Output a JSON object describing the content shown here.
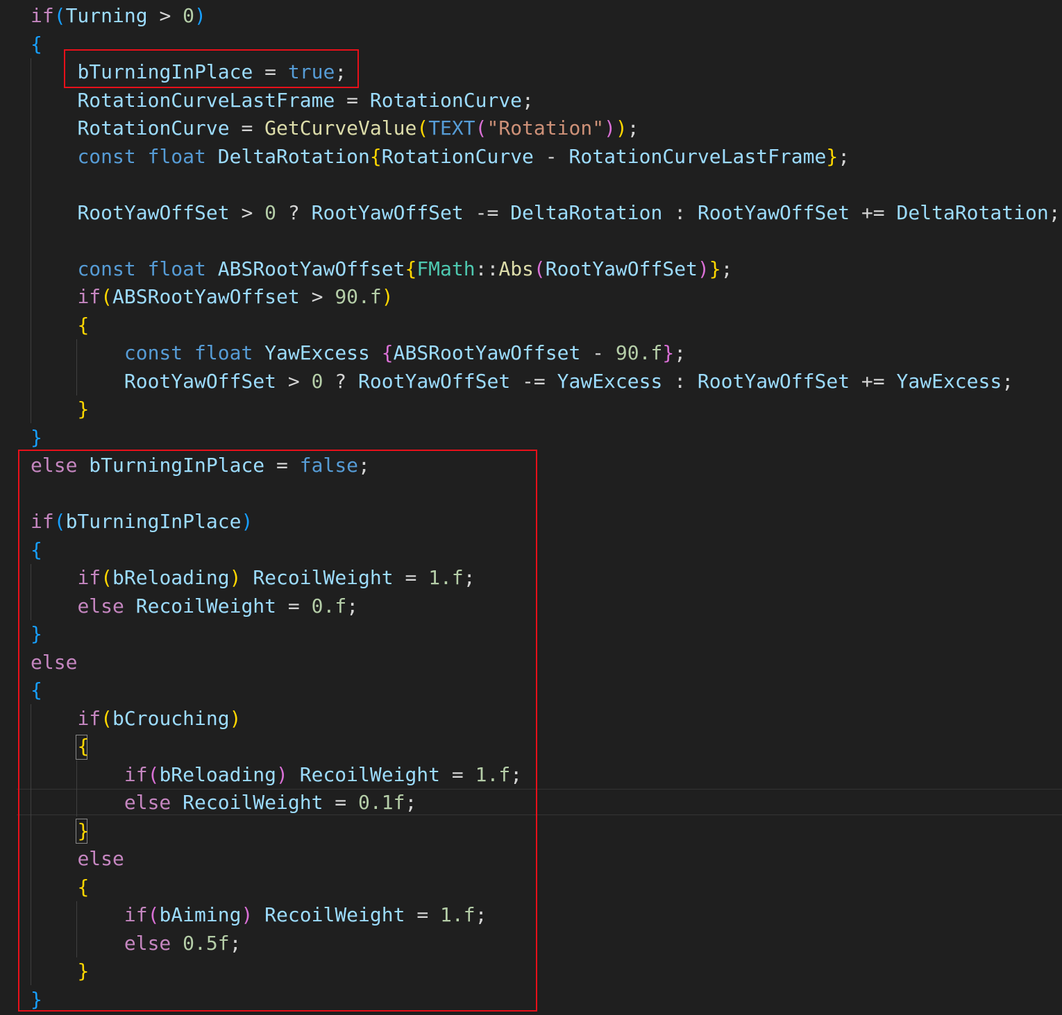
{
  "editor": {
    "colors": {
      "background": "#1f1f1f",
      "keyword_control": "#c586c0",
      "keyword_type": "#569cd6",
      "variable": "#9cdcfe",
      "function": "#dcdcaa",
      "class": "#4ec9b0",
      "number": "#b5cea8",
      "string": "#ce9178",
      "punctuation": "#d4d4d4",
      "bracket_level1": "#179fff",
      "bracket_level2": "#ffd700",
      "bracket_level3": "#da70d6",
      "annotation_box": "#e8101a"
    },
    "lines": [
      [
        [
          "kw",
          "if"
        ],
        [
          "b1",
          "("
        ],
        [
          "var",
          "Turning"
        ],
        [
          "p",
          " > "
        ],
        [
          "num",
          "0"
        ],
        [
          "b1",
          ")"
        ]
      ],
      [
        [
          "b1",
          "{"
        ]
      ],
      [
        [
          "p",
          "    "
        ],
        [
          "var",
          "bTurningInPlace"
        ],
        [
          "p",
          " = "
        ],
        [
          "typ",
          "true"
        ],
        [
          "p",
          ";"
        ]
      ],
      [
        [
          "p",
          "    "
        ],
        [
          "var",
          "RotationCurveLastFrame"
        ],
        [
          "p",
          " = "
        ],
        [
          "var",
          "RotationCurve"
        ],
        [
          "p",
          ";"
        ]
      ],
      [
        [
          "p",
          "    "
        ],
        [
          "var",
          "RotationCurve"
        ],
        [
          "p",
          " = "
        ],
        [
          "fn",
          "GetCurveValue"
        ],
        [
          "b2",
          "("
        ],
        [
          "typ",
          "TEXT"
        ],
        [
          "b3",
          "("
        ],
        [
          "str",
          "\"Rotation\""
        ],
        [
          "b3",
          ")"
        ],
        [
          "b2",
          ")"
        ],
        [
          "p",
          ";"
        ]
      ],
      [
        [
          "p",
          "    "
        ],
        [
          "typ",
          "const"
        ],
        [
          "p",
          " "
        ],
        [
          "typ",
          "float"
        ],
        [
          "p",
          " "
        ],
        [
          "var",
          "DeltaRotation"
        ],
        [
          "b2",
          "{"
        ],
        [
          "var",
          "RotationCurve"
        ],
        [
          "p",
          " - "
        ],
        [
          "var",
          "RotationCurveLastFrame"
        ],
        [
          "b2",
          "}"
        ],
        [
          "p",
          ";"
        ]
      ],
      [],
      [
        [
          "p",
          "    "
        ],
        [
          "var",
          "RootYawOffSet"
        ],
        [
          "p",
          " > "
        ],
        [
          "num",
          "0"
        ],
        [
          "p",
          " ? "
        ],
        [
          "var",
          "RootYawOffSet"
        ],
        [
          "p",
          " -= "
        ],
        [
          "var",
          "DeltaRotation"
        ],
        [
          "p",
          " : "
        ],
        [
          "var",
          "RootYawOffSet"
        ],
        [
          "p",
          " += "
        ],
        [
          "var",
          "DeltaRotation"
        ],
        [
          "p",
          ";"
        ]
      ],
      [],
      [
        [
          "p",
          "    "
        ],
        [
          "typ",
          "const"
        ],
        [
          "p",
          " "
        ],
        [
          "typ",
          "float"
        ],
        [
          "p",
          " "
        ],
        [
          "var",
          "ABSRootYawOffset"
        ],
        [
          "b2",
          "{"
        ],
        [
          "cls",
          "FMath"
        ],
        [
          "p",
          "::"
        ],
        [
          "fn",
          "Abs"
        ],
        [
          "b3",
          "("
        ],
        [
          "var",
          "RootYawOffSet"
        ],
        [
          "b3",
          ")"
        ],
        [
          "b2",
          "}"
        ],
        [
          "p",
          ";"
        ]
      ],
      [
        [
          "p",
          "    "
        ],
        [
          "kw",
          "if"
        ],
        [
          "b2",
          "("
        ],
        [
          "var",
          "ABSRootYawOffset"
        ],
        [
          "p",
          " > "
        ],
        [
          "num",
          "90.f"
        ],
        [
          "b2",
          ")"
        ]
      ],
      [
        [
          "p",
          "    "
        ],
        [
          "b2",
          "{"
        ]
      ],
      [
        [
          "p",
          "        "
        ],
        [
          "typ",
          "const"
        ],
        [
          "p",
          " "
        ],
        [
          "typ",
          "float"
        ],
        [
          "p",
          " "
        ],
        [
          "var",
          "YawExcess"
        ],
        [
          "p",
          " "
        ],
        [
          "b3",
          "{"
        ],
        [
          "var",
          "ABSRootYawOffset"
        ],
        [
          "p",
          " - "
        ],
        [
          "num",
          "90.f"
        ],
        [
          "b3",
          "}"
        ],
        [
          "p",
          ";"
        ]
      ],
      [
        [
          "p",
          "        "
        ],
        [
          "var",
          "RootYawOffSet"
        ],
        [
          "p",
          " > "
        ],
        [
          "num",
          "0"
        ],
        [
          "p",
          " ? "
        ],
        [
          "var",
          "RootYawOffSet"
        ],
        [
          "p",
          " -= "
        ],
        [
          "var",
          "YawExcess"
        ],
        [
          "p",
          " : "
        ],
        [
          "var",
          "RootYawOffSet"
        ],
        [
          "p",
          " += "
        ],
        [
          "var",
          "YawExcess"
        ],
        [
          "p",
          ";"
        ]
      ],
      [
        [
          "p",
          "    "
        ],
        [
          "b2",
          "}"
        ]
      ],
      [
        [
          "b1",
          "}"
        ]
      ],
      [
        [
          "kw",
          "else"
        ],
        [
          "p",
          " "
        ],
        [
          "var",
          "bTurningInPlace"
        ],
        [
          "p",
          " = "
        ],
        [
          "typ",
          "false"
        ],
        [
          "p",
          ";"
        ]
      ],
      [],
      [
        [
          "kw",
          "if"
        ],
        [
          "b1",
          "("
        ],
        [
          "var",
          "bTurningInPlace"
        ],
        [
          "b1",
          ")"
        ]
      ],
      [
        [
          "b1",
          "{"
        ]
      ],
      [
        [
          "p",
          "    "
        ],
        [
          "kw",
          "if"
        ],
        [
          "b2",
          "("
        ],
        [
          "var",
          "bReloading"
        ],
        [
          "b2",
          ")"
        ],
        [
          "p",
          " "
        ],
        [
          "var",
          "RecoilWeight"
        ],
        [
          "p",
          " = "
        ],
        [
          "num",
          "1.f"
        ],
        [
          "p",
          ";"
        ]
      ],
      [
        [
          "p",
          "    "
        ],
        [
          "kw",
          "else"
        ],
        [
          "p",
          " "
        ],
        [
          "var",
          "RecoilWeight"
        ],
        [
          "p",
          " = "
        ],
        [
          "num",
          "0.f"
        ],
        [
          "p",
          ";"
        ]
      ],
      [
        [
          "b1",
          "}"
        ]
      ],
      [
        [
          "kw",
          "else"
        ]
      ],
      [
        [
          "b1",
          "{"
        ]
      ],
      [
        [
          "p",
          "    "
        ],
        [
          "kw",
          "if"
        ],
        [
          "b2",
          "("
        ],
        [
          "var",
          "bCrouching"
        ],
        [
          "b2",
          ")"
        ]
      ],
      [
        [
          "p",
          "    "
        ],
        [
          "b2",
          "{"
        ]
      ],
      [
        [
          "p",
          "        "
        ],
        [
          "kw",
          "if"
        ],
        [
          "b3",
          "("
        ],
        [
          "var",
          "bReloading"
        ],
        [
          "b3",
          ")"
        ],
        [
          "p",
          " "
        ],
        [
          "var",
          "RecoilWeight"
        ],
        [
          "p",
          " = "
        ],
        [
          "num",
          "1.f"
        ],
        [
          "p",
          ";"
        ]
      ],
      [
        [
          "p",
          "        "
        ],
        [
          "kw",
          "else"
        ],
        [
          "p",
          " "
        ],
        [
          "var",
          "RecoilWeight"
        ],
        [
          "p",
          " = "
        ],
        [
          "num",
          "0.1f"
        ],
        [
          "p",
          ";"
        ]
      ],
      [
        [
          "p",
          "    "
        ],
        [
          "b2",
          "}"
        ]
      ],
      [
        [
          "p",
          "    "
        ],
        [
          "kw",
          "else"
        ]
      ],
      [
        [
          "p",
          "    "
        ],
        [
          "b2",
          "{"
        ]
      ],
      [
        [
          "p",
          "        "
        ],
        [
          "kw",
          "if"
        ],
        [
          "b3",
          "("
        ],
        [
          "var",
          "bAiming"
        ],
        [
          "b3",
          ")"
        ],
        [
          "p",
          " "
        ],
        [
          "var",
          "RecoilWeight"
        ],
        [
          "p",
          " = "
        ],
        [
          "num",
          "1.f"
        ],
        [
          "p",
          ";"
        ]
      ],
      [
        [
          "p",
          "        "
        ],
        [
          "kw",
          "else"
        ],
        [
          "p",
          " "
        ],
        [
          "num",
          "0.5f"
        ],
        [
          "p",
          ";"
        ]
      ],
      [
        [
          "p",
          "    "
        ],
        [
          "b2",
          "}"
        ]
      ],
      [
        [
          "b1",
          "}"
        ]
      ]
    ]
  }
}
